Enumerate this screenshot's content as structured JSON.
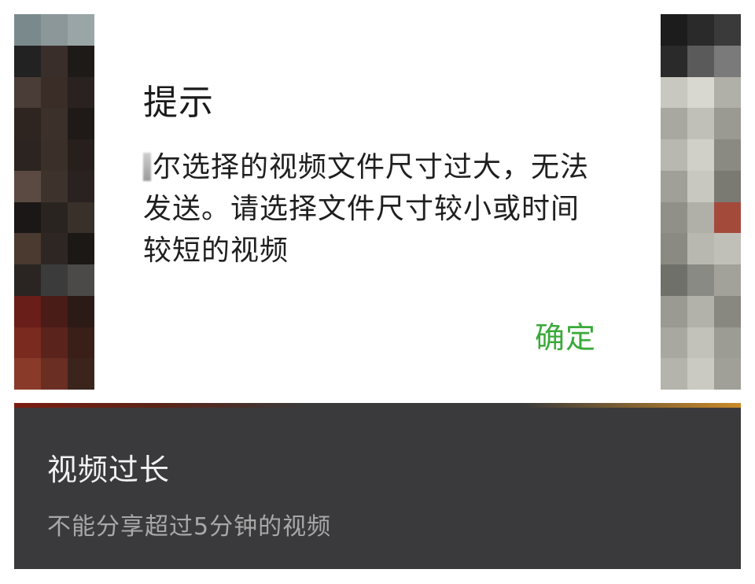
{
  "dialog": {
    "title": "提示",
    "message": "你选择的视频文件尺寸过大，无法发送。请选择文件尺寸较小或时间较短的视频",
    "message_visible": "尔选择的视频文件尺寸过大，无法发送。请选择文件尺寸较小或时间较短的视频",
    "confirm_label": "确定",
    "confirm_color": "#3aa93a"
  },
  "notice": {
    "title": "视频过长",
    "subtitle": "不能分享超过5分钟的视频",
    "background_color": "#3a3a3c"
  },
  "background": {
    "content": "pixelated-video-frame",
    "left_pixels": [
      "#7a8a8c",
      "#8b9799",
      "#9aa5a6",
      "#222222",
      "#3a2e2a",
      "#1e1a18",
      "#4a3c36",
      "#3a2c26",
      "#2a2220",
      "#2e2521",
      "#3c302a",
      "#1f1a18",
      "#2b2421",
      "#3a2f29",
      "#261f1c",
      "#5a4a42",
      "#3d322c",
      "#2a2220",
      "#1a1716",
      "#2a2420",
      "#3a302a",
      "#4a3a30",
      "#2e2622",
      "#1c1816",
      "#2a2522",
      "#3b3b3b",
      "#4b4a48",
      "#6a1e1a",
      "#4a1c18",
      "#2c1a16",
      "#7a2a1e",
      "#5a241c",
      "#3a1e18",
      "#8a3a28",
      "#6a2e22",
      "#3a241c"
    ],
    "right_pixels": [
      "#1c1c1c",
      "#2a2a2a",
      "#3a3a3a",
      "#2a2a2a",
      "#5a5a5a",
      "#7a7a7a",
      "#c8c8c0",
      "#d8d8d0",
      "#b0b0a8",
      "#a8a8a0",
      "#c0c0b8",
      "#9a9a92",
      "#b8b8b0",
      "#d0d0c8",
      "#8a8a82",
      "#a0a098",
      "#c8c8c0",
      "#7a7a72",
      "#909088",
      "#b0b0a8",
      "#a44a3a",
      "#8a8a82",
      "#b8b8b0",
      "#c0c0b8",
      "#70706a",
      "#8a8a84",
      "#a2a29a",
      "#9a9a92",
      "#b2b2aa",
      "#888880",
      "#a8a8a0",
      "#c2c2ba",
      "#9c9c94",
      "#b4b4ac",
      "#cacac2",
      "#a0a098"
    ]
  }
}
